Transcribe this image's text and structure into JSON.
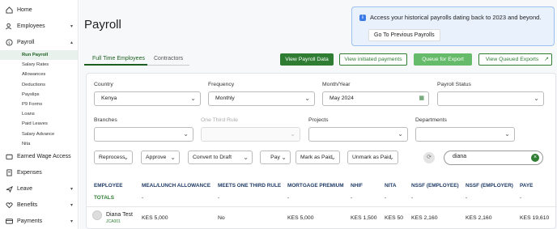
{
  "sidebar": {
    "items": [
      {
        "label": "Home",
        "icon": "home-icon"
      },
      {
        "label": "Employees",
        "icon": "users-icon"
      },
      {
        "label": "Payroll",
        "icon": "money-icon"
      },
      {
        "label": "Earned Wage Access",
        "icon": "wallet-icon"
      },
      {
        "label": "Expenses",
        "icon": "receipt-icon"
      },
      {
        "label": "Leave",
        "icon": "plane-icon"
      },
      {
        "label": "Benefits",
        "icon": "heart-icon"
      },
      {
        "label": "Payments",
        "icon": "card-icon"
      }
    ],
    "payroll_subitems": [
      "Run Payroll",
      "Salary Rates",
      "Allowances",
      "Deductions",
      "Payslips",
      "P9 Forms",
      "Loans",
      "Paid Leaves",
      "Salary Advance",
      "Nita"
    ]
  },
  "page": {
    "title": "Payroll"
  },
  "banner": {
    "message": "Access your historical payrolls dating back to 2023 and beyond.",
    "button": "Go To Previous Payrolls"
  },
  "tabs": {
    "active": "Full Time Employees",
    "inactive": "Contractors"
  },
  "actions": {
    "view_payroll_data": "View Payroll Data",
    "view_initiated_payments": "View initiated payments",
    "queue_for_export": "Queue for Export",
    "view_queued_exports": "View Queued Exports"
  },
  "filters": {
    "country": {
      "label": "Country",
      "value": "Kenya"
    },
    "frequency": {
      "label": "Frequency",
      "value": "Monthly"
    },
    "month_year": {
      "label": "Month/Year",
      "value": "May 2024"
    },
    "payroll_status": {
      "label": "Payroll Status",
      "value": ""
    },
    "branches": {
      "label": "Branches",
      "value": ""
    },
    "one_third_rule": {
      "label": "One Third Rule",
      "value": ""
    },
    "projects": {
      "label": "Projects",
      "value": ""
    },
    "departments": {
      "label": "Departments",
      "value": ""
    }
  },
  "bulk_actions": {
    "reprocess": "Reprocess",
    "approve": "Approve",
    "convert_to_draft": "Convert to Draft",
    "pay": "Pay",
    "mark_as_paid": "Mark as Paid",
    "unmark_as_paid": "Unmark as Paid"
  },
  "search": {
    "value": "diana"
  },
  "table": {
    "headers": [
      "EMPLOYEE",
      "MEAL/LUNCH ALLOWANCE",
      "MEETS ONE THIRD RULE",
      "MORTGAGE PREMIUM",
      "NHIF",
      "NITA",
      "NSSF (EMPLOYEE)",
      "NSSF (EMPLOYER)",
      "PAYE"
    ],
    "totals": [
      "TOTALS",
      "-",
      "-",
      "-",
      "-",
      "-",
      "-",
      "-",
      "-"
    ],
    "rows": [
      {
        "name": "Diana Test",
        "id": "JCA001",
        "cells": [
          "KES 5,000",
          "No",
          "KES 5,000",
          "KES 1,500",
          "KES 50",
          "KES 2,160",
          "KES 2,160",
          "KES 19,610"
        ]
      }
    ]
  },
  "colors": {
    "brand_green": "#2e7d32",
    "info_blue": "#3b7be8",
    "header_navy": "#1f3b66"
  }
}
